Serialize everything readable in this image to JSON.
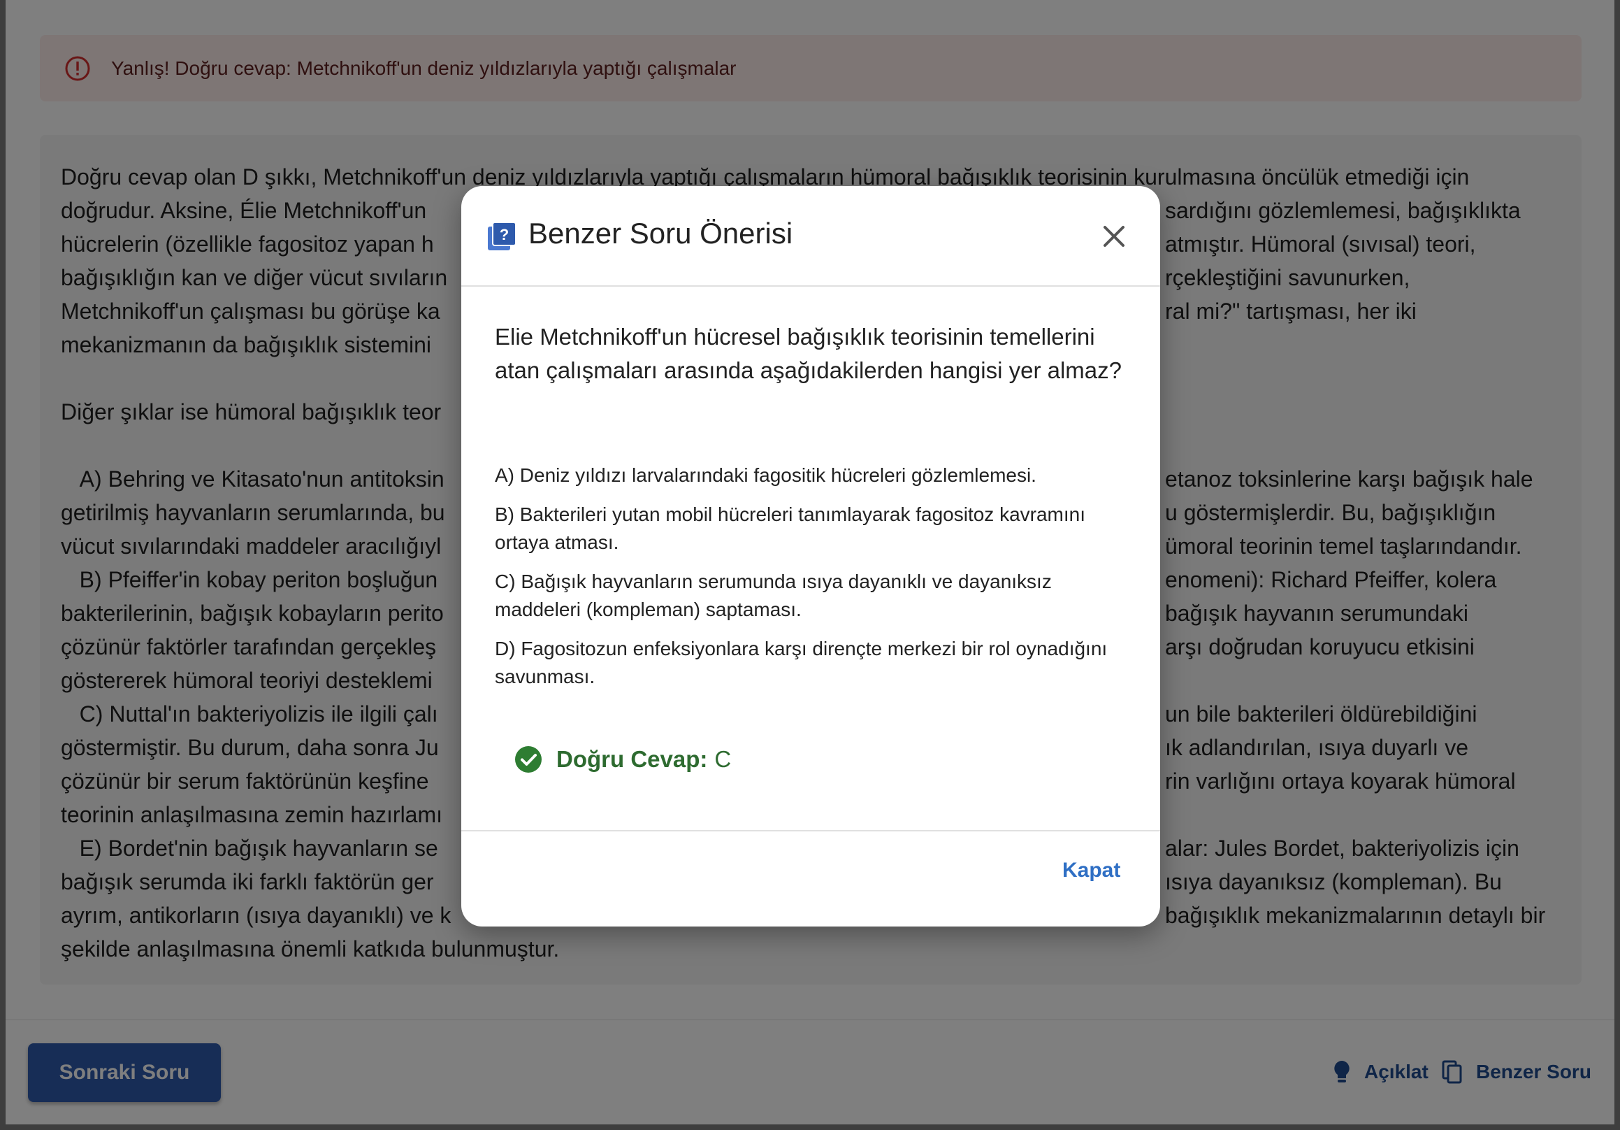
{
  "alert": {
    "text": "Yanlış! Doğru cevap: Metchnikoff'un deniz yıldızlarıyla yaptığı çalışmalar",
    "icon": "error-outline-icon"
  },
  "explanation": {
    "lines_p1": [
      "Doğru cevap olan D şıkkı, Metchnikoff'un deniz yıldızlarıyla yaptığı çalışmaların hümoral bağışıklık teorisinin kurulmasına öncülük etmediği için",
      "doğrudur. Aksine, Élie Metchnikoff'un",
      "hücrelerin (özellikle fagositoz yapan h",
      "bağışıklığın kan ve diğer vücut sıvıların",
      "Metchnikoff'un çalışması bu görüşe ka",
      "mekanizmanın da bağışıklık sistemini"
    ],
    "right_p1": [
      "",
      "sardığını gözlemlemesi, bağışıklıkta",
      "atmıştır. Hümoral (sıvısal) teori,",
      "rçekleştiğini savunurken,",
      "ral mi?\" tartışması, her iki",
      ""
    ],
    "line_p2": "Diğer şıklar ise hümoral bağışıklık teor",
    "lines_p3": [
      "   A) Behring ve Kitasato'nun antitoksin",
      "getirilmiş hayvanların serumlarında, bu",
      "vücut sıvılarındaki maddeler aracılığıyl",
      "   B) Pfeiffer'in kobay periton boşluğun",
      "bakterilerinin, bağışık kobayların perito",
      "çözünür faktörler tarafından gerçekleş",
      "göstererek hümoral teoriyi desteklemi",
      "   C) Nuttal'ın bakteriyolizis ile ilgili çalı",
      "göstermiştir. Bu durum, daha sonra Ju",
      "çözünür bir serum faktörünün keşfine",
      "teorinin anlaşılmasına zemin hazırlamı",
      "   E) Bordet'nin bağışık hayvanların se",
      "bağışık serumda iki farklı faktörün ger",
      "ayrım, antikorların (ısıya dayanıklı) ve k",
      "şekilde anlaşılmasına önemli katkıda bulunmuştur."
    ],
    "right_p3": [
      "etanoz toksinlerine karşı bağışık hale",
      "u göstermişlerdir. Bu, bağışıklığın",
      "ümoral teorinin temel taşlarındandır.",
      "enomeni): Richard Pfeiffer, kolera",
      "bağışık hayvanın serumundaki",
      "arşı doğrudan koruyucu etkisini",
      "",
      "un bile bakterileri öldürebildiğini",
      "ık adlandırılan, ısıya duyarlı ve",
      "rin varlığını ortaya koyarak hümoral",
      "",
      "alar: Jules Bordet, bakteriyolizis için",
      "ısıya dayanıksız (kompleman). Bu",
      "bağışıklık mekanizmalarının detaylı bir",
      ""
    ]
  },
  "footer": {
    "next_label": "Sonraki Soru",
    "explain_label": "Açıklat",
    "similar_label": "Benzer Soru"
  },
  "modal": {
    "title": "Benzer Soru Önerisi",
    "question": "Elie Metchnikoff'un hücresel bağışıklık teorisinin temellerini atan çalışmaları arasında aşağıdakilerden hangisi yer almaz?",
    "options": [
      "A) Deniz yıldızı larvalarındaki fagositik hücreleri gözlemlemesi.",
      "B) Bakterileri yutan mobil hücreleri tanımlayarak fagositoz kavramını ortaya atması.",
      "C) Bağışık hayvanların serumunda ısıya dayanıklı ve dayanıksız maddeleri (kompleman) saptaması.",
      "D) Fagositozun enfeksiyonlara karşı dirençte merkezi bir rol oynadığını savunması."
    ],
    "answer_label": "Doğru Cevap:",
    "answer_value": "C",
    "close_label": "Kapat"
  },
  "colors": {
    "primary": "#2e5aac",
    "success": "#2e6b30",
    "error": "#c62828",
    "link": "#2f6fc4"
  }
}
